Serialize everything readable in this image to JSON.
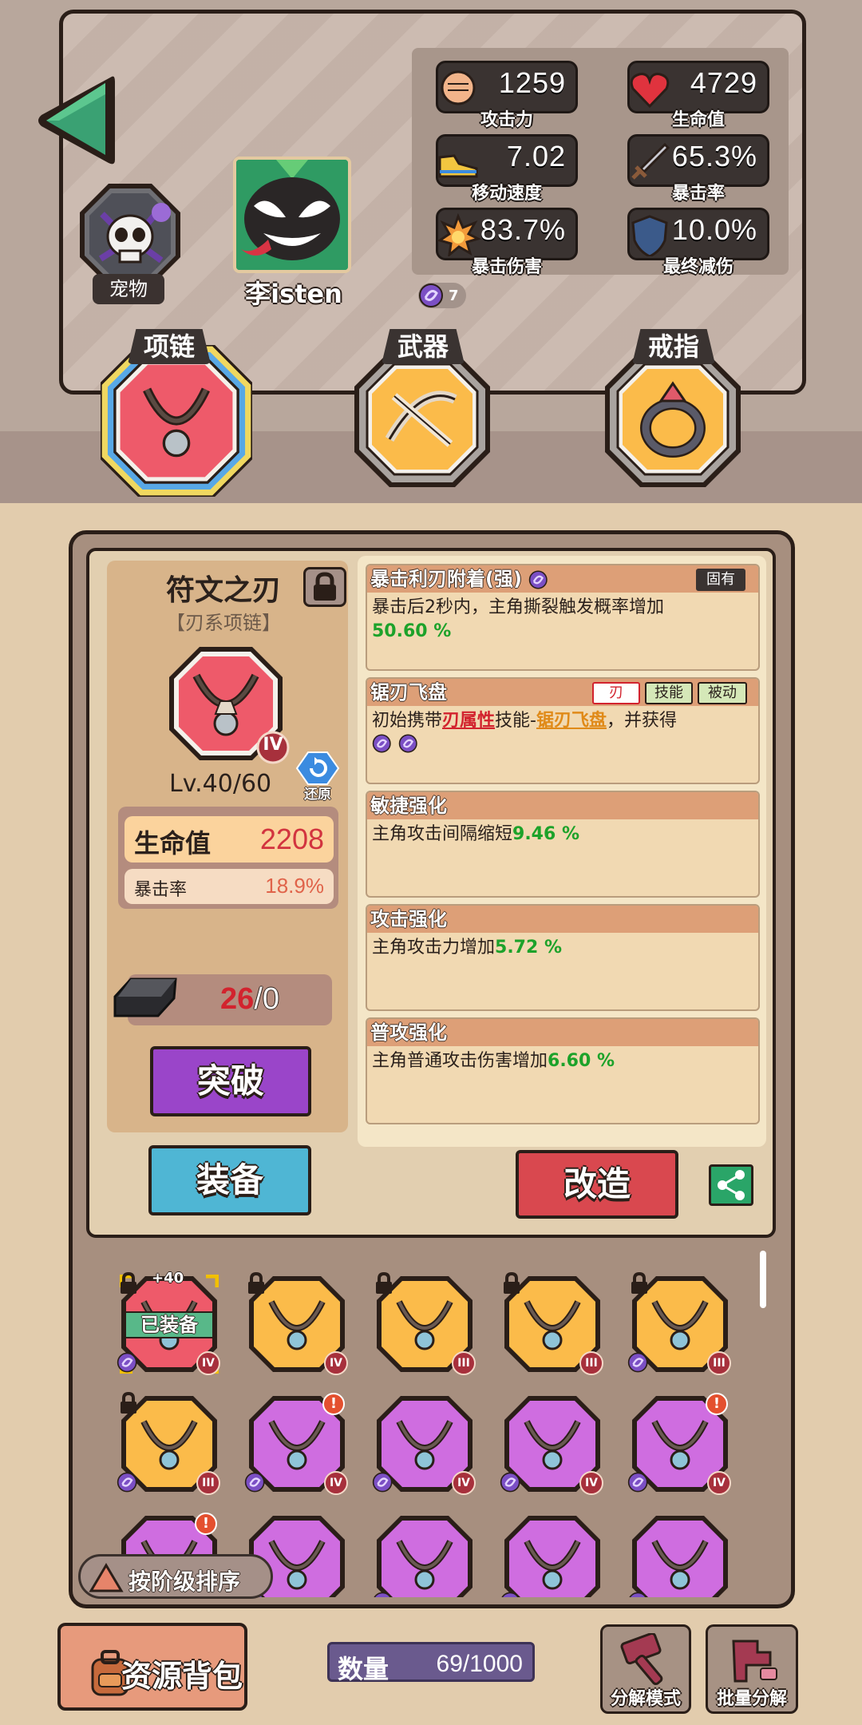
{
  "stats": [
    {
      "icon": "fist-icon",
      "value": "1259",
      "label": "攻击力"
    },
    {
      "icon": "heart-icon",
      "value": "4729",
      "label": "生命值"
    },
    {
      "icon": "shoe-icon",
      "value": "7.02",
      "label": "移动速度"
    },
    {
      "icon": "sword-icon",
      "value": "65.3%",
      "label": "暴击率"
    },
    {
      "icon": "explosion-icon",
      "value": "83.7%",
      "label": "暴击伤害"
    },
    {
      "icon": "shield-icon",
      "value": "10.0%",
      "label": "最终减伤"
    }
  ],
  "pet_label": "宠物",
  "player_name": "李isten",
  "token_count": "7",
  "slots": [
    {
      "label": "项链",
      "selected": true
    },
    {
      "label": "武器",
      "selected": false
    },
    {
      "label": "戒指",
      "selected": false
    }
  ],
  "item": {
    "name": "符文之刃",
    "type": "【刃系项链】",
    "tier": "IV",
    "level": "Lv.40/60",
    "restore_label": "还原",
    "hp_label": "生命值",
    "hp_value": "2208",
    "crit_label": "暴击率",
    "crit_value": "18.9%",
    "ore_have": "26",
    "ore_need": "/0",
    "breakthrough_label": "突破",
    "equip_label": "装备",
    "reforge_label": "改造"
  },
  "affixes": [
    {
      "title": "暴击利刃附着(强)",
      "tags": [
        "固有"
      ],
      "desc": "暴击后2秒内，主角撕裂触发概率增加",
      "highlight": "50.60 %"
    },
    {
      "title": "锯刃飞盘",
      "tags": [
        "刃",
        "技能",
        "被动"
      ],
      "desc_parts": [
        "初始携带",
        "刃属性",
        "技能-",
        "锯刃飞盘",
        "，并获得"
      ]
    },
    {
      "title": "敏捷强化",
      "desc": "主角攻击间隔缩短",
      "highlight": "9.46 %"
    },
    {
      "title": "攻击强化",
      "desc": "主角攻击力增加",
      "highlight": "5.72 %"
    },
    {
      "title": "普攻强化",
      "desc": "主角普通攻击伤害增加",
      "highlight": "6.60 %"
    }
  ],
  "inventory": [
    {
      "color": "red",
      "tier": "IV",
      "locked": true,
      "equipped": true,
      "bonus": "+40",
      "alert": false
    },
    {
      "color": "orange",
      "tier": "IV",
      "locked": true,
      "equipped": false,
      "alert": false
    },
    {
      "color": "orange",
      "tier": "III",
      "locked": true,
      "equipped": false,
      "alert": false
    },
    {
      "color": "orange",
      "tier": "III",
      "locked": true,
      "equipped": false,
      "alert": false
    },
    {
      "color": "orange",
      "tier": "III",
      "locked": true,
      "equipped": false,
      "alert": false
    },
    {
      "color": "orange",
      "tier": "III",
      "locked": true,
      "equipped": false,
      "alert": false
    },
    {
      "color": "purple",
      "tier": "IV",
      "locked": false,
      "equipped": false,
      "alert": true
    },
    {
      "color": "purple",
      "tier": "IV",
      "locked": false,
      "equipped": false,
      "alert": false
    },
    {
      "color": "purple",
      "tier": "IV",
      "locked": false,
      "equipped": false,
      "alert": false
    },
    {
      "color": "purple",
      "tier": "IV",
      "locked": false,
      "equipped": false,
      "alert": true
    },
    {
      "color": "purple",
      "tier": "",
      "locked": false,
      "equipped": false,
      "alert": true
    },
    {
      "color": "purple",
      "tier": "",
      "locked": false,
      "equipped": false,
      "alert": false
    },
    {
      "color": "purple",
      "tier": "",
      "locked": false,
      "equipped": false,
      "alert": false
    },
    {
      "color": "purple",
      "tier": "",
      "locked": false,
      "equipped": false,
      "alert": false
    },
    {
      "color": "purple",
      "tier": "",
      "locked": false,
      "equipped": false,
      "alert": false
    }
  ],
  "equipped_label": "已装备",
  "sort_label": "按阶级排序",
  "bottom": {
    "resource_bag": "资源背包",
    "count_label": "数量",
    "count_value": "69/1000",
    "decompose_mode": "分解模式",
    "batch_decompose": "批量分解"
  }
}
